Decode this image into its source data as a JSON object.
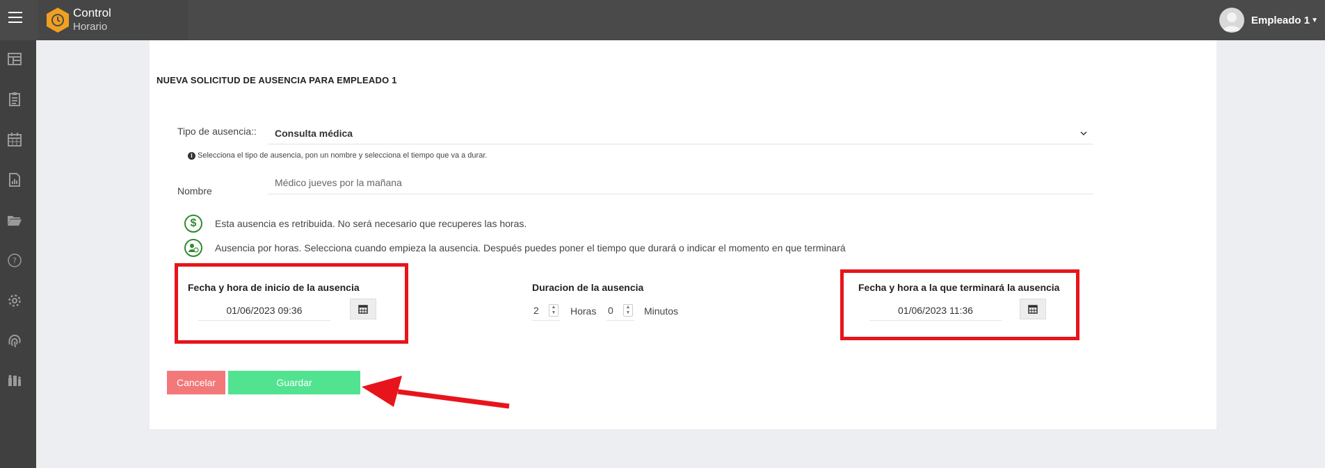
{
  "app": {
    "logo_line1": "Control",
    "logo_line2": "Horario",
    "brand_color": "#f0a020"
  },
  "user": {
    "name": "Empleado 1"
  },
  "sidebar": {
    "items": [
      {
        "icon": "dashboard-icon"
      },
      {
        "icon": "clipboard-icon"
      },
      {
        "icon": "calendar-icon"
      },
      {
        "icon": "report-icon"
      },
      {
        "icon": "folder-open-icon"
      },
      {
        "icon": "help-icon"
      },
      {
        "icon": "gear-icon"
      },
      {
        "icon": "fingerprint-icon"
      },
      {
        "icon": "team-icon"
      }
    ]
  },
  "page": {
    "title": "NUEVA SOLICITUD DE AUSENCIA PARA EMPLEADO 1"
  },
  "form": {
    "type_label": "Tipo de ausencia::",
    "type_value": "Consulta médica",
    "hint": "Selecciona el tipo de ausencia, pon un nombre y selecciona el tiempo que va a durar.",
    "name_label": "Nombre",
    "name_value": "Médico jueves por la mañana",
    "paid_info": "Esta ausencia es retribuida. No será necesario que recuperes las horas.",
    "hours_info": "Ausencia por horas. Selecciona cuando empieza la ausencia. Después puedes poner el tiempo que durará o indicar el momento en que terminará",
    "start_label": "Fecha y hora de inicio de la ausencia",
    "start_value": "01/06/2023 09:36",
    "duration_label": "Duracion de la ausencia",
    "hours_value": "2",
    "hours_unit": "Horas",
    "minutes_value": "0",
    "minutes_unit": "Minutos",
    "end_label": "Fecha y hora a la que terminará la ausencia",
    "end_value": "01/06/2023 11:36",
    "cancel_label": "Cancelar",
    "save_label": "Guardar"
  },
  "colors": {
    "topbar": "#4a4a4a",
    "sidebar": "#404040",
    "cancel": "#f2787a",
    "save": "#52e391",
    "annotation": "#e8141b",
    "icon_green": "#2e8b2e"
  }
}
